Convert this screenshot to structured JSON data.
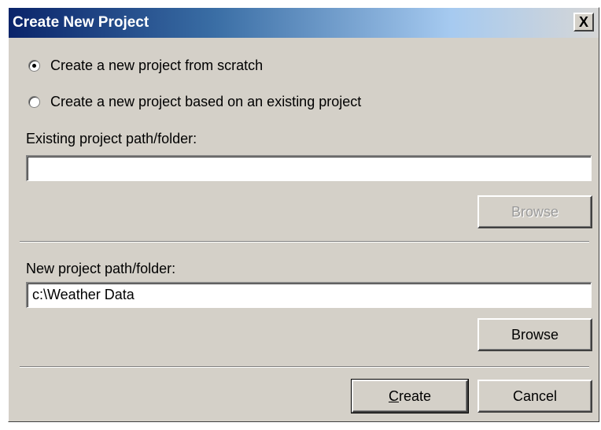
{
  "window": {
    "title": "Create New Project",
    "close_glyph": "X"
  },
  "options": {
    "from_scratch_label": "Create a new project from scratch",
    "from_existing_label": "Create a new project based on an existing project",
    "selected": "from_scratch"
  },
  "existing": {
    "label": "Existing project path/folder:",
    "value": "",
    "browse_label": "Browse",
    "enabled": false
  },
  "new_project": {
    "label": "New project path/folder:",
    "value": "c:\\Weather Data",
    "browse_label": "Browse"
  },
  "actions": {
    "create_prefix": "C",
    "create_rest": "reate",
    "cancel_label": "Cancel"
  },
  "colors": {
    "dialog_bg": "#d4d0c8",
    "title_start": "#0a246a",
    "title_end": "#d6d6d6"
  },
  "icons": {
    "close": "close-icon",
    "radio": "radio-icon"
  }
}
